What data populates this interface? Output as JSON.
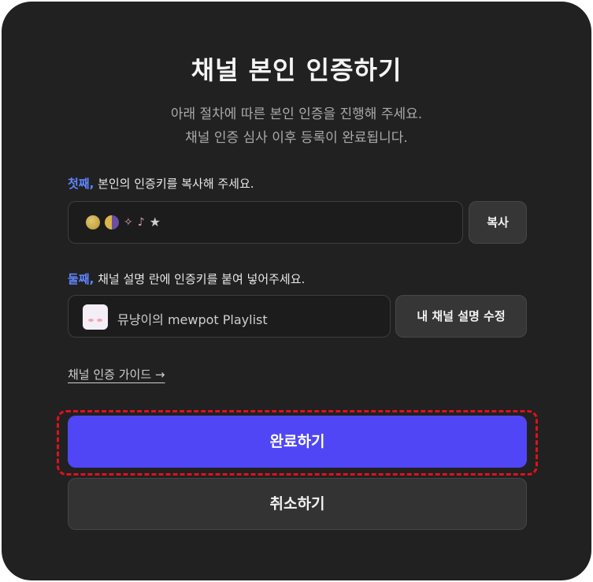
{
  "dialog": {
    "title": "채널 본인 인증하기",
    "subtitle_line1": "아래 절차에 따른 본인 인증을 진행해 주세요.",
    "subtitle_line2": "채널 인증 심사 이후 등록이 완료됩니다."
  },
  "step1": {
    "highlight": "첫째,",
    "text": " 본인의 인증키를 복사해 주세요.",
    "key_icons": [
      "moon-icon",
      "half-moon-icon",
      "sparkle-icon",
      "guitar-icon",
      "star-icon"
    ],
    "copy_label": "복사"
  },
  "step2": {
    "highlight": "둘째,",
    "text": " 채널 설명 란에 인증키를 붙여 넣어주세요.",
    "channel_name": "뮤냥이의 mewpot Playlist",
    "edit_label": "내 채널 설명 수정"
  },
  "guide_link": "채널 인증 가이드 →",
  "buttons": {
    "complete": "완료하기",
    "cancel": "취소하기"
  },
  "colors": {
    "accent": "#5046f5",
    "step_highlight": "#5f86ff",
    "dialog_bg": "#212121",
    "annotation": "#e0101d"
  }
}
